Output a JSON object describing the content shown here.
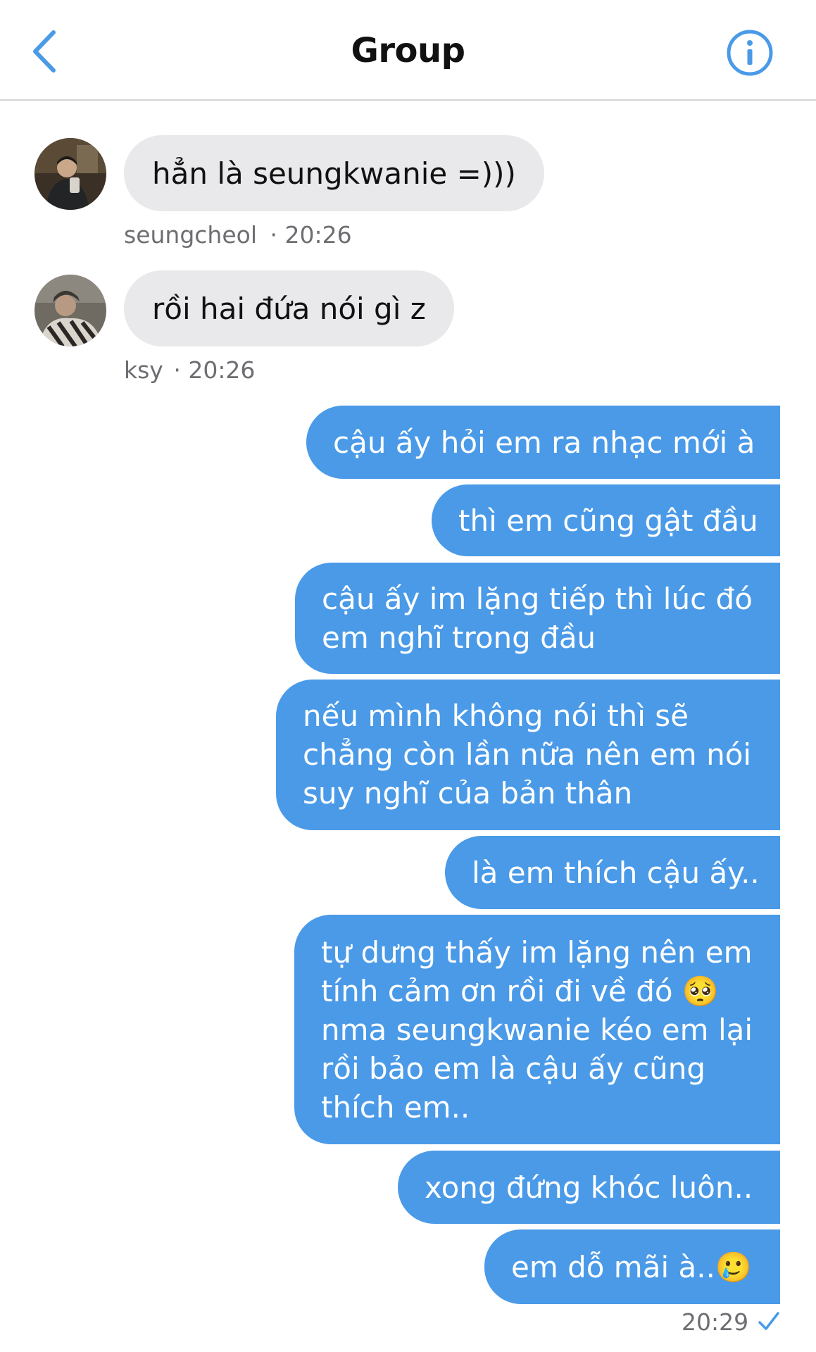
{
  "header": {
    "title": "Group"
  },
  "incoming": [
    {
      "text": "hẳn là seungkwanie =)))",
      "sender": "seungcheol",
      "time": "· 20:26"
    },
    {
      "text": "rồi hai đứa nói gì z",
      "sender": "ksy",
      "time": "· 20:26"
    }
  ],
  "outgoing": [
    {
      "lines": [
        "cậu ấy hỏi em ra nhạc mới à"
      ]
    },
    {
      "lines": [
        "thì em cũng gật đầu"
      ]
    },
    {
      "lines": [
        "cậu ấy im lặng tiếp thì lúc đó",
        "em nghĩ trong đầu"
      ]
    },
    {
      "lines": [
        "nếu mình không nói thì sẽ",
        "chẳng còn lần nữa nên em nói",
        "suy nghĩ của bản thân"
      ]
    },
    {
      "lines": [
        "là em thích cậu ấy.."
      ]
    },
    {
      "lines": [
        "tự dưng thấy im lặng nên em",
        "tính cảm ơn rồi đi về đó 🥺",
        "nma seungkwanie kéo em lại",
        "rồi bảo em là cậu ấy cũng",
        "thích em.."
      ]
    },
    {
      "lines": [
        "xong đứng khóc luôn.."
      ]
    },
    {
      "lines": [
        "em dỗ mãi à..🥲"
      ]
    }
  ],
  "last_time": "20:29",
  "colors": {
    "accent": "#4a9ae8",
    "incoming_bg": "#e9e9ec"
  }
}
